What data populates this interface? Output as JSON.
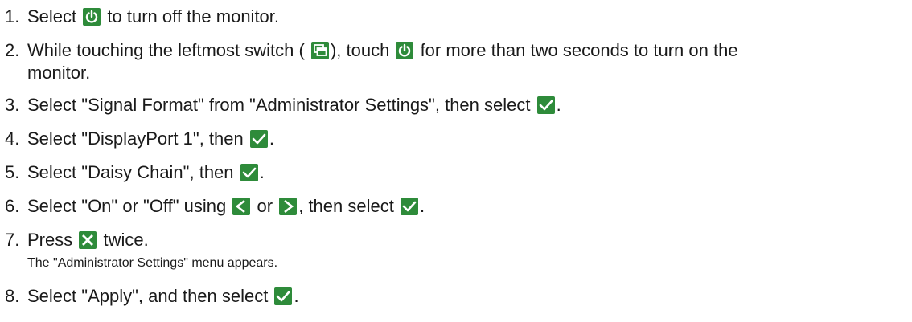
{
  "steps": [
    {
      "num": "1.",
      "a": "Select",
      "b": "to turn off the monitor."
    },
    {
      "num": "2.",
      "a": "While touching the leftmost switch (",
      "b": "), touch",
      "c": "for more than two seconds to turn on the",
      "d": "monitor."
    },
    {
      "num": "3.",
      "a": "Select \"Signal Format\" from \"Administrator Settings\", then select",
      "b": "."
    },
    {
      "num": "4.",
      "a": "Select \"DisplayPort 1\", then",
      "b": "."
    },
    {
      "num": "5.",
      "a": "Select \"Daisy Chain\", then",
      "b": "."
    },
    {
      "num": "6.",
      "a": "Select \"On\" or \"Off\" using",
      "b": "or",
      "c": ", then select",
      "d": "."
    },
    {
      "num": "7.",
      "a": "Press",
      "b": "twice.",
      "note": "The \"Administrator Settings\" menu appears."
    },
    {
      "num": "8.",
      "a": "Select \"Apply\", and then select",
      "b": "."
    }
  ],
  "icons": {
    "power": "power-icon",
    "input": "input-switch-icon",
    "check": "check-icon",
    "left": "left-arrow-icon",
    "right": "right-arrow-icon",
    "close": "close-icon"
  },
  "colors": {
    "icon_bg": "#2e8b3a",
    "icon_fg": "#ffffff"
  }
}
